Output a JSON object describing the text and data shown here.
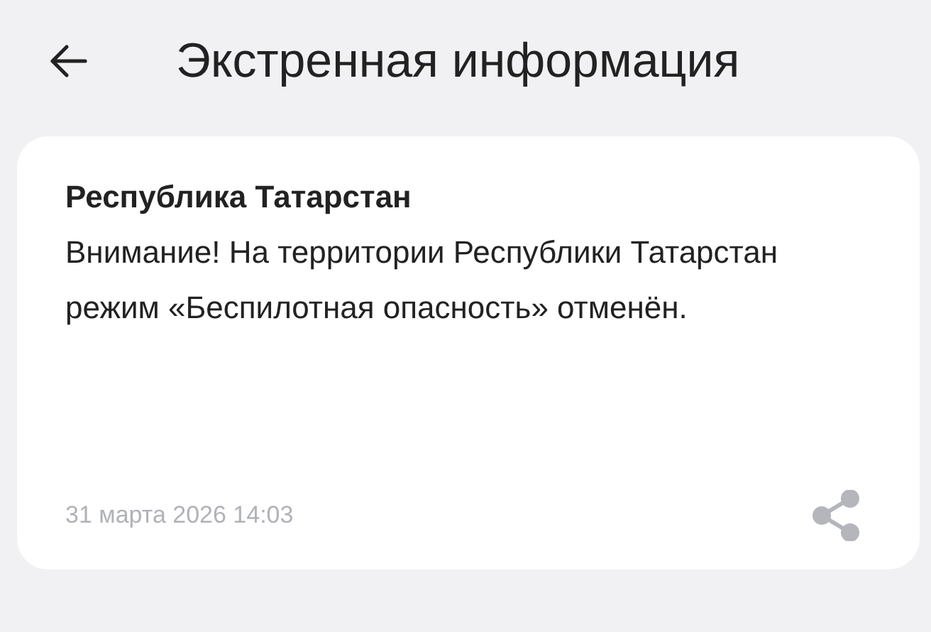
{
  "header": {
    "title": "Экстренная информация"
  },
  "alert": {
    "region": "Республика Татарстан",
    "message": "Внимание! На территории Республики Татарстан режим «Беспилотная опасность» отменён.",
    "date": "31 марта 2026 14:03"
  }
}
